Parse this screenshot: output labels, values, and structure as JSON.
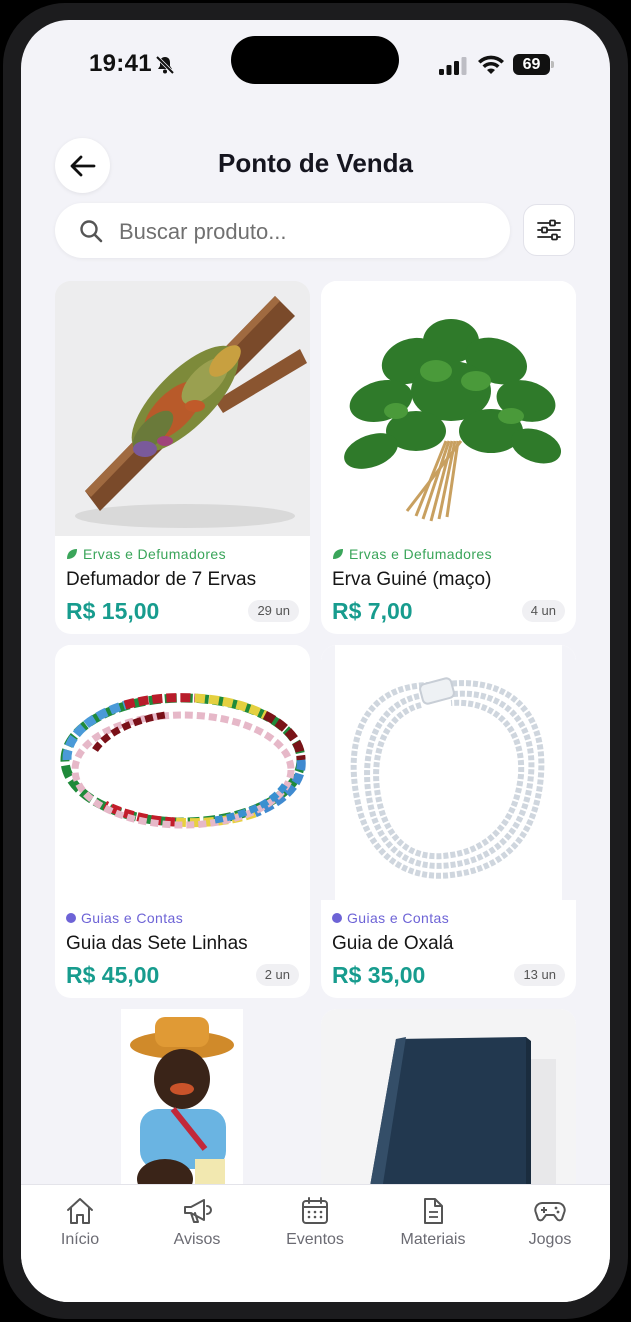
{
  "status": {
    "time": "19:41",
    "battery": "69"
  },
  "header": {
    "title": "Ponto de Venda",
    "back_icon": "arrow-left-icon"
  },
  "search": {
    "placeholder": "Buscar produto...",
    "value": ""
  },
  "filter_icon": "sliders-icon",
  "products": [
    {
      "category": "Ervas e Defumadores",
      "category_icon": "leaf-icon",
      "category_color": "#3aa55a",
      "name": "Defumador de 7 Ervas",
      "price": "R$ 15,00",
      "stock": "29 un"
    },
    {
      "category": "Ervas e Defumadores",
      "category_icon": "leaf-icon",
      "category_color": "#3aa55a",
      "name": "Erva Guiné (maço)",
      "price": "R$ 7,00",
      "stock": "4 un"
    },
    {
      "category": "Guias e Contas",
      "category_icon": "dot-icon",
      "category_color": "#6d63d6",
      "name": "Guia das Sete Linhas",
      "price": "R$ 45,00",
      "stock": "2 un"
    },
    {
      "category": "Guias e Contas",
      "category_icon": "dot-icon",
      "category_color": "#6d63d6",
      "name": "Guia de Oxalá",
      "price": "R$ 35,00",
      "stock": "13 un"
    }
  ],
  "tabs": [
    {
      "label": "Início",
      "icon": "home-icon"
    },
    {
      "label": "Avisos",
      "icon": "megaphone-icon"
    },
    {
      "label": "Eventos",
      "icon": "calendar-icon"
    },
    {
      "label": "Materiais",
      "icon": "document-icon"
    },
    {
      "label": "Jogos",
      "icon": "gamepad-icon"
    }
  ],
  "colors": {
    "price": "#179c8e",
    "background": "#f3f3f8",
    "accent_green": "#3aa55a",
    "accent_purple": "#6d63d6"
  }
}
